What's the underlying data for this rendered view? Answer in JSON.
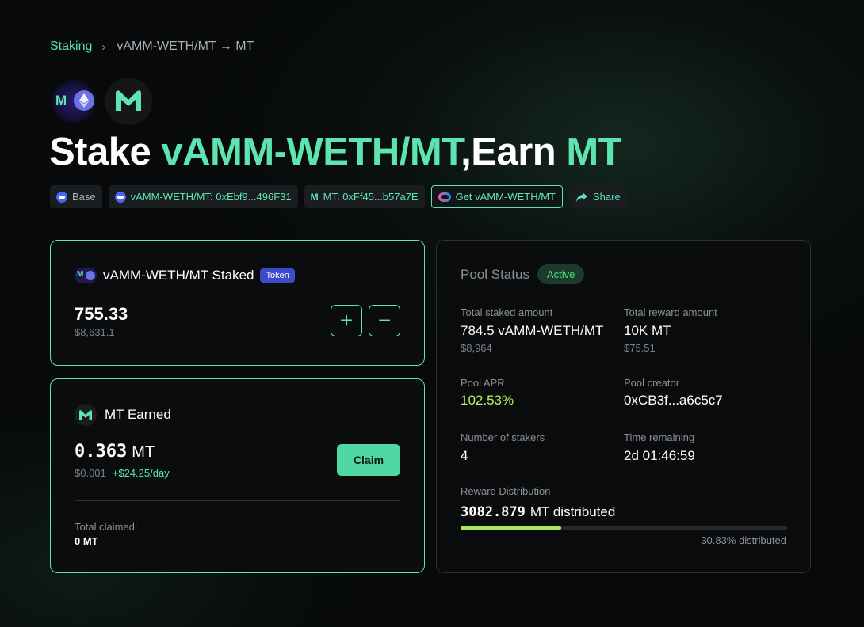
{
  "breadcrumb": {
    "root": "Staking",
    "separator": "›",
    "current": "vAMM-WETH/MT → MT"
  },
  "headline": {
    "prefix": "Stake ",
    "stake_token": "vAMM-WETH/MT",
    "comma": ",",
    "middle": "Earn ",
    "earn_token": "MT"
  },
  "logos": {
    "pair_letter": "M",
    "earn_letter": "M"
  },
  "chips": {
    "network": "Base",
    "stake_contract": "vAMM-WETH/MT: 0xEbf9...496F31",
    "reward_contract": "MT: 0xFf45...b57a7E",
    "get_token": "Get vAMM-WETH/MT",
    "share": "Share"
  },
  "staked_card": {
    "title": "vAMM-WETH/MT Staked",
    "badge": "Token",
    "amount": "755.33",
    "usd": "$8,631.1",
    "add_label": "+",
    "remove_label": "−"
  },
  "earned_card": {
    "title": "MT Earned",
    "amount": "0.363",
    "unit": "MT",
    "usd": "$0.001",
    "rate": "+$24.25/day",
    "claim_label": "Claim",
    "total_claimed_label": "Total claimed:",
    "total_claimed_value": "0 MT"
  },
  "pool": {
    "title": "Pool Status",
    "status": "Active",
    "total_staked_label": "Total staked amount",
    "total_staked_value": "784.5 vAMM-WETH/MT",
    "total_staked_usd": "$8,964",
    "total_reward_label": "Total reward amount",
    "total_reward_value": "10K MT",
    "total_reward_usd": "$75.51",
    "apr_label": "Pool APR",
    "apr_value": "102.53%",
    "creator_label": "Pool creator",
    "creator_value": "0xCB3f...a6c5c7",
    "stakers_label": "Number of stakers",
    "stakers_value": "4",
    "time_label": "Time remaining",
    "time_value": "2d 01:46:59",
    "dist_label": "Reward Distribution",
    "dist_amount": "3082.879",
    "dist_suffix": "MT distributed",
    "dist_percent_text": "30.83% distributed",
    "dist_fraction": 0.3083
  },
  "colors": {
    "accent": "#5ee4b0",
    "apr": "#b6f36a",
    "progress": "#a3ea5c",
    "active": "#4ade80"
  }
}
